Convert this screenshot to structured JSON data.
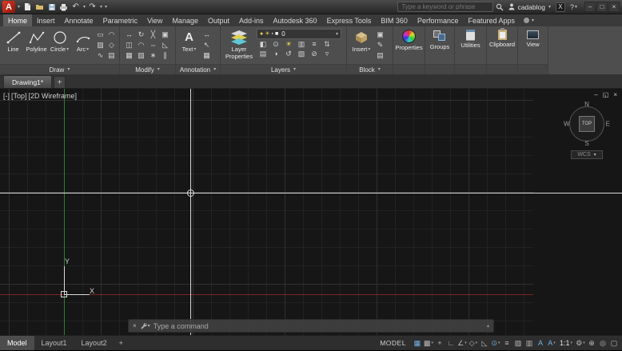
{
  "colors": {
    "accent_blue": "#6fb3e8",
    "logo_red": "#d42b1e",
    "axis_green": "#2e7d32",
    "axis_red": "#7e2626",
    "crosshair": "#d9d9d9",
    "layer_yellow": "#e8d34e"
  },
  "ui": {
    "caret": "▾",
    "up": "▴"
  },
  "titlebar": {
    "logo_letter": "A",
    "undo_glyph": "↶",
    "redo_glyph": "↷",
    "search_placeholder": "Type a keyword or phrase",
    "signin_label": "cadablog",
    "exchange_label": "X",
    "help_label": "?",
    "win_min": "–",
    "win_max": "□",
    "win_close": "×"
  },
  "ribbon_tabs": [
    {
      "label": "Home",
      "active": true
    },
    {
      "label": "Insert"
    },
    {
      "label": "Annotate"
    },
    {
      "label": "Parametric"
    },
    {
      "label": "View"
    },
    {
      "label": "Manage"
    },
    {
      "label": "Output"
    },
    {
      "label": "Add-ins"
    },
    {
      "label": "Autodesk 360"
    },
    {
      "label": "Express Tools"
    },
    {
      "label": "BIM 360"
    },
    {
      "label": "Performance"
    },
    {
      "label": "Featured Apps"
    }
  ],
  "draw_panel": {
    "label": "Draw",
    "buttons": [
      {
        "label": "Line"
      },
      {
        "label": "Polyline"
      },
      {
        "label": "Circle"
      },
      {
        "label": "Arc"
      }
    ],
    "small_icons": [
      {
        "name": "rectangle",
        "glyph": "▭"
      },
      {
        "name": "ellipse",
        "glyph": "◠"
      },
      {
        "name": "hatch",
        "glyph": "▨"
      },
      {
        "name": "polygon",
        "glyph": "◇"
      },
      {
        "name": "spline",
        "glyph": "∿"
      },
      {
        "name": "gradient",
        "glyph": "▤"
      }
    ]
  },
  "modify_panel": {
    "label": "Modify",
    "small_icons": [
      {
        "name": "move",
        "glyph": "↔"
      },
      {
        "name": "rotate",
        "glyph": "↻"
      },
      {
        "name": "trim",
        "glyph": "╳"
      },
      {
        "name": "copy",
        "glyph": "▣"
      },
      {
        "name": "mirror",
        "glyph": "◫"
      },
      {
        "name": "fillet",
        "glyph": "◠"
      },
      {
        "name": "stretch",
        "glyph": "⇔"
      },
      {
        "name": "scale",
        "glyph": "◺"
      },
      {
        "name": "array",
        "glyph": "▦"
      },
      {
        "name": "erase",
        "glyph": "▨"
      },
      {
        "name": "explode",
        "glyph": "∗"
      },
      {
        "name": "offset",
        "glyph": "∥"
      }
    ]
  },
  "annotation_panel": {
    "label": "Annotation",
    "text_button": {
      "label": "Text",
      "glyph": "A"
    },
    "small_icons": [
      {
        "name": "dimension",
        "glyph": "↔"
      },
      {
        "name": "leader",
        "glyph": "↖"
      },
      {
        "name": "table",
        "glyph": "▦"
      }
    ]
  },
  "layers_panel": {
    "label": "Layers",
    "layer_properties_label": "Layer Properties",
    "dropdown": {
      "value": "0",
      "bulb": "●",
      "sun": "☀",
      "lock": "▪",
      "swatch": "■"
    },
    "small_icons": [
      {
        "name": "layer-off",
        "glyph": "◧"
      },
      {
        "name": "layer-isolate",
        "glyph": "⊙"
      },
      {
        "name": "layer-freeze",
        "glyph": "☀"
      },
      {
        "name": "layer-lock",
        "glyph": "▥"
      },
      {
        "name": "layer-match",
        "glyph": "≡"
      },
      {
        "name": "make-current",
        "glyph": "⇅"
      },
      {
        "name": "layer-state",
        "glyph": "▤"
      },
      {
        "name": "layer-walk",
        "glyph": "◑"
      },
      {
        "name": "layer-prev",
        "glyph": "↺"
      },
      {
        "name": "layer-merge",
        "glyph": "▧"
      },
      {
        "name": "layer-delete",
        "glyph": "⊘"
      },
      {
        "name": "layer-unlock",
        "glyph": "▿"
      }
    ]
  },
  "block_panel": {
    "label": "Block",
    "insert_label": "Insert",
    "small_icons": [
      {
        "name": "create-block",
        "glyph": "▣"
      },
      {
        "name": "edit-block",
        "glyph": "✎"
      },
      {
        "name": "define-attributes",
        "glyph": "▤"
      }
    ]
  },
  "simple_panels": [
    {
      "label": "Properties"
    },
    {
      "label": "Groups"
    },
    {
      "label": "Utilities"
    },
    {
      "label": "Clipboard"
    },
    {
      "label": "View"
    }
  ],
  "doc_bar": {
    "tab_label": "Drawing1*",
    "new_tab": "+"
  },
  "viewport": {
    "controls": [
      {
        "label": "[-]"
      },
      {
        "label": "[Top]"
      },
      {
        "label": "[2D Wireframe]"
      }
    ],
    "win_min": "–",
    "win_restore": "◱",
    "win_close": "×",
    "viewcube": {
      "n": "N",
      "w": "W",
      "e": "E",
      "s": "S",
      "top": "TOP",
      "wcs": "WCS"
    },
    "ucs": {
      "x_label": "X",
      "y_label": "Y"
    }
  },
  "command_line": {
    "close": "×",
    "prompt": "Type a command"
  },
  "statusbar": {
    "tabs": [
      {
        "label": "Model",
        "active": true
      },
      {
        "label": "Layout1"
      },
      {
        "label": "Layout2"
      }
    ],
    "new_layout": "+",
    "model_label": "MODEL",
    "icons": [
      {
        "name": "grid-display",
        "glyph": "▦",
        "active": true
      },
      {
        "name": "snap-mode",
        "glyph": "▩",
        "caret": true
      },
      {
        "name": "dynamic-input",
        "glyph": "+"
      },
      {
        "name": "ortho-mode",
        "glyph": "∟"
      },
      {
        "name": "polar-tracking",
        "glyph": "∠",
        "caret": true
      },
      {
        "name": "isometric-drafting",
        "glyph": "◇",
        "caret": true
      },
      {
        "name": "object-snap-tracking",
        "glyph": "◺"
      },
      {
        "name": "object-snap",
        "glyph": "⊙",
        "active": true,
        "caret": true
      },
      {
        "name": "lineweight",
        "glyph": "≡"
      },
      {
        "name": "transparency",
        "glyph": "▨"
      },
      {
        "name": "selection-cycling",
        "glyph": "▥"
      },
      {
        "name": "annotation-visibility",
        "glyph": "A",
        "active": true
      },
      {
        "name": "autoscale",
        "glyph": "A",
        "active": true,
        "caret": true
      },
      {
        "name": "annotation-scale",
        "glyph": "1:1",
        "caret": true,
        "wide": true
      },
      {
        "name": "workspace-switching",
        "glyph": "⚙",
        "caret": true
      },
      {
        "name": "annotation-monitor",
        "glyph": "⊕"
      },
      {
        "name": "isolate-objects",
        "glyph": "◎"
      },
      {
        "name": "clean-screen",
        "glyph": "▢"
      }
    ]
  }
}
